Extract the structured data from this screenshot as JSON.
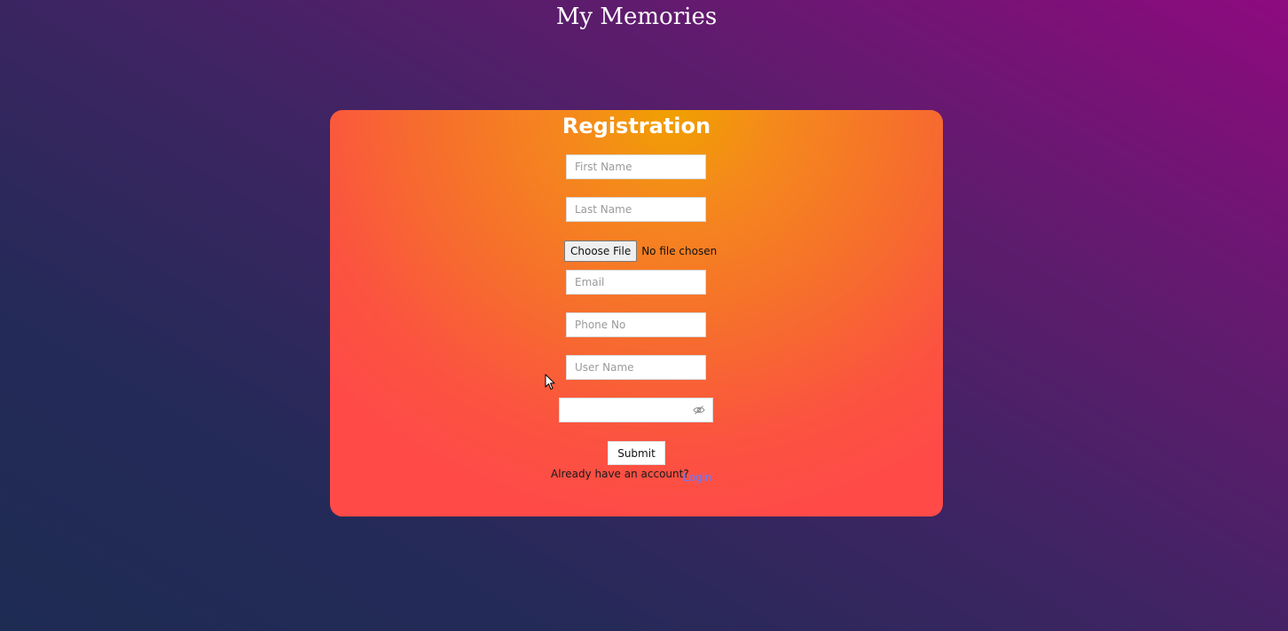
{
  "header": {
    "title": "My Memories"
  },
  "form": {
    "title": "Registration",
    "first_name_placeholder": "First Name",
    "last_name_placeholder": "Last Name",
    "file_button_label": "Choose File",
    "file_status": "No file chosen",
    "email_placeholder": "Email",
    "phone_placeholder": "Phone No",
    "username_placeholder": "User Name",
    "password_value": "",
    "password_toggle_icon": "eye-slash-icon",
    "submit_label": "Submit",
    "account_prompt": "Already have an account?",
    "login_link": "Login"
  },
  "colors": {
    "background_start": "#1e2b53",
    "background_end": "#8e0a7f",
    "card_top": "#f0a000",
    "card_bottom": "#ff4a48",
    "link": "#6a7cff"
  }
}
